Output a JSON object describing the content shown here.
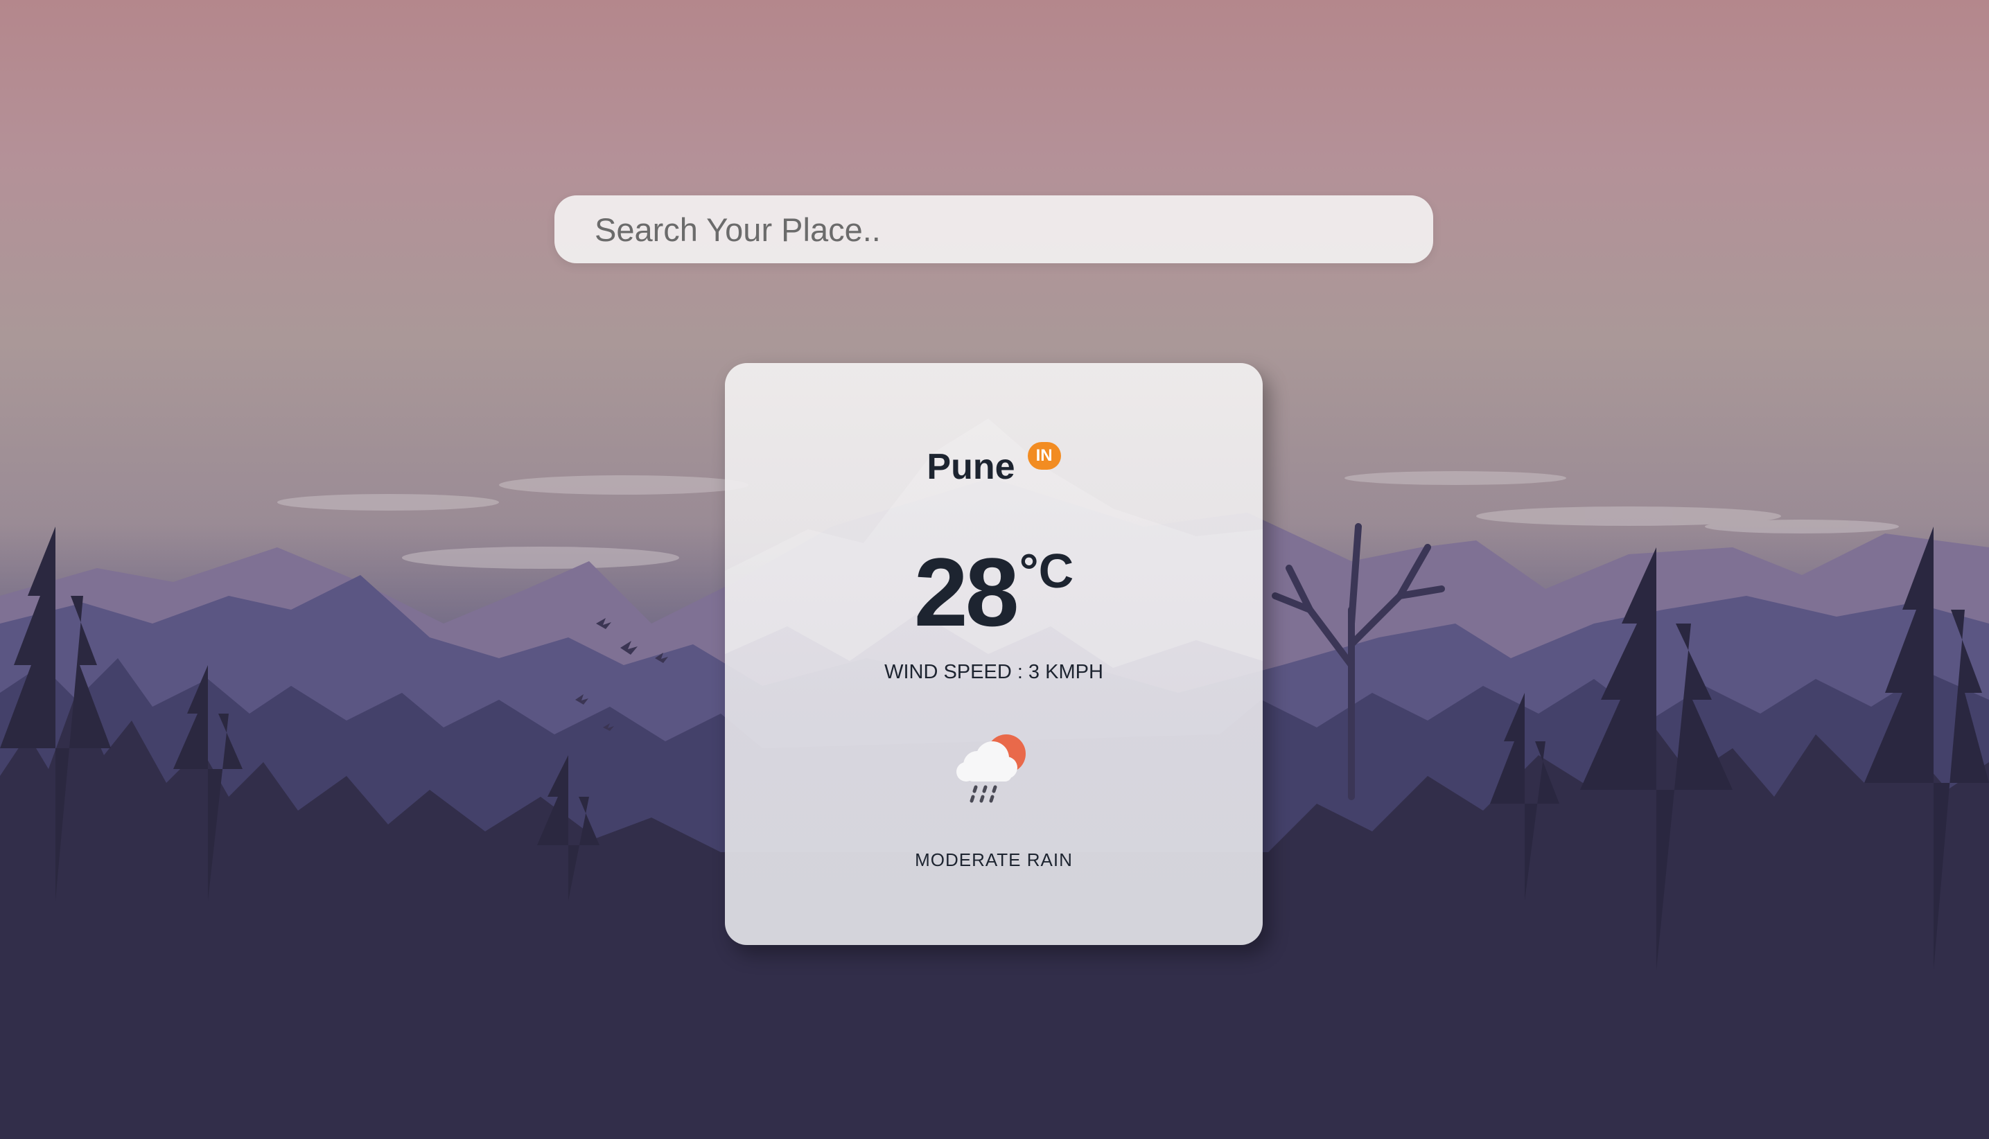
{
  "search": {
    "placeholder": "Search Your Place..",
    "value": ""
  },
  "weather": {
    "city": "Pune",
    "country_code": "IN",
    "temperature": "28",
    "unit": "°C",
    "wind": "WIND SPEED : 3 KMPH",
    "condition": "MODERATE RAIN",
    "icon": "cloud-sun-rain-icon"
  },
  "colors": {
    "badge": "#f28c22",
    "sun": "#e9694a",
    "text": "#1d2430"
  }
}
